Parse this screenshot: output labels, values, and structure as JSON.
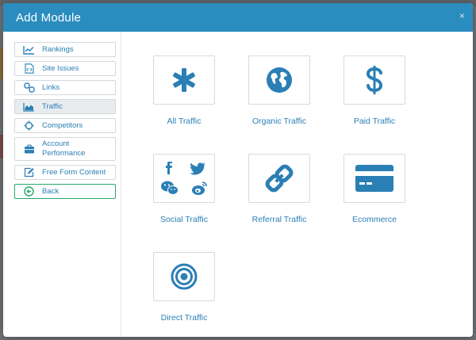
{
  "modal": {
    "title": "Add Module",
    "close_glyph": "×"
  },
  "sidebar": {
    "items": [
      {
        "label": "Rankings",
        "icon": "line-chart-icon"
      },
      {
        "label": "Site Issues",
        "icon": "code-file-icon"
      },
      {
        "label": "Links",
        "icon": "chain-link-icon"
      },
      {
        "label": "Traffic",
        "icon": "area-chart-icon",
        "active": true
      },
      {
        "label": "Competitors",
        "icon": "crosshair-icon"
      },
      {
        "label": "Account Performance",
        "icon": "briefcase-icon"
      },
      {
        "label": "Free Form Content",
        "icon": "edit-icon"
      },
      {
        "label": "Back",
        "icon": "circle-arrow-left-icon"
      }
    ]
  },
  "modules": [
    {
      "label": "All Traffic",
      "icon": "asterisk-icon"
    },
    {
      "label": "Organic Traffic",
      "icon": "globe-icon"
    },
    {
      "label": "Paid Traffic",
      "icon": "dollar-icon"
    },
    {
      "label": "Social Traffic",
      "icon": "social-icons"
    },
    {
      "label": "Referral Traffic",
      "icon": "link-icon"
    },
    {
      "label": "Ecommerce",
      "icon": "credit-card-icon"
    },
    {
      "label": "Direct Traffic",
      "icon": "target-icon"
    }
  ],
  "colors": {
    "header": "#2a8cbf",
    "icon": "#2a7fb5",
    "back_border": "#27a86a"
  }
}
